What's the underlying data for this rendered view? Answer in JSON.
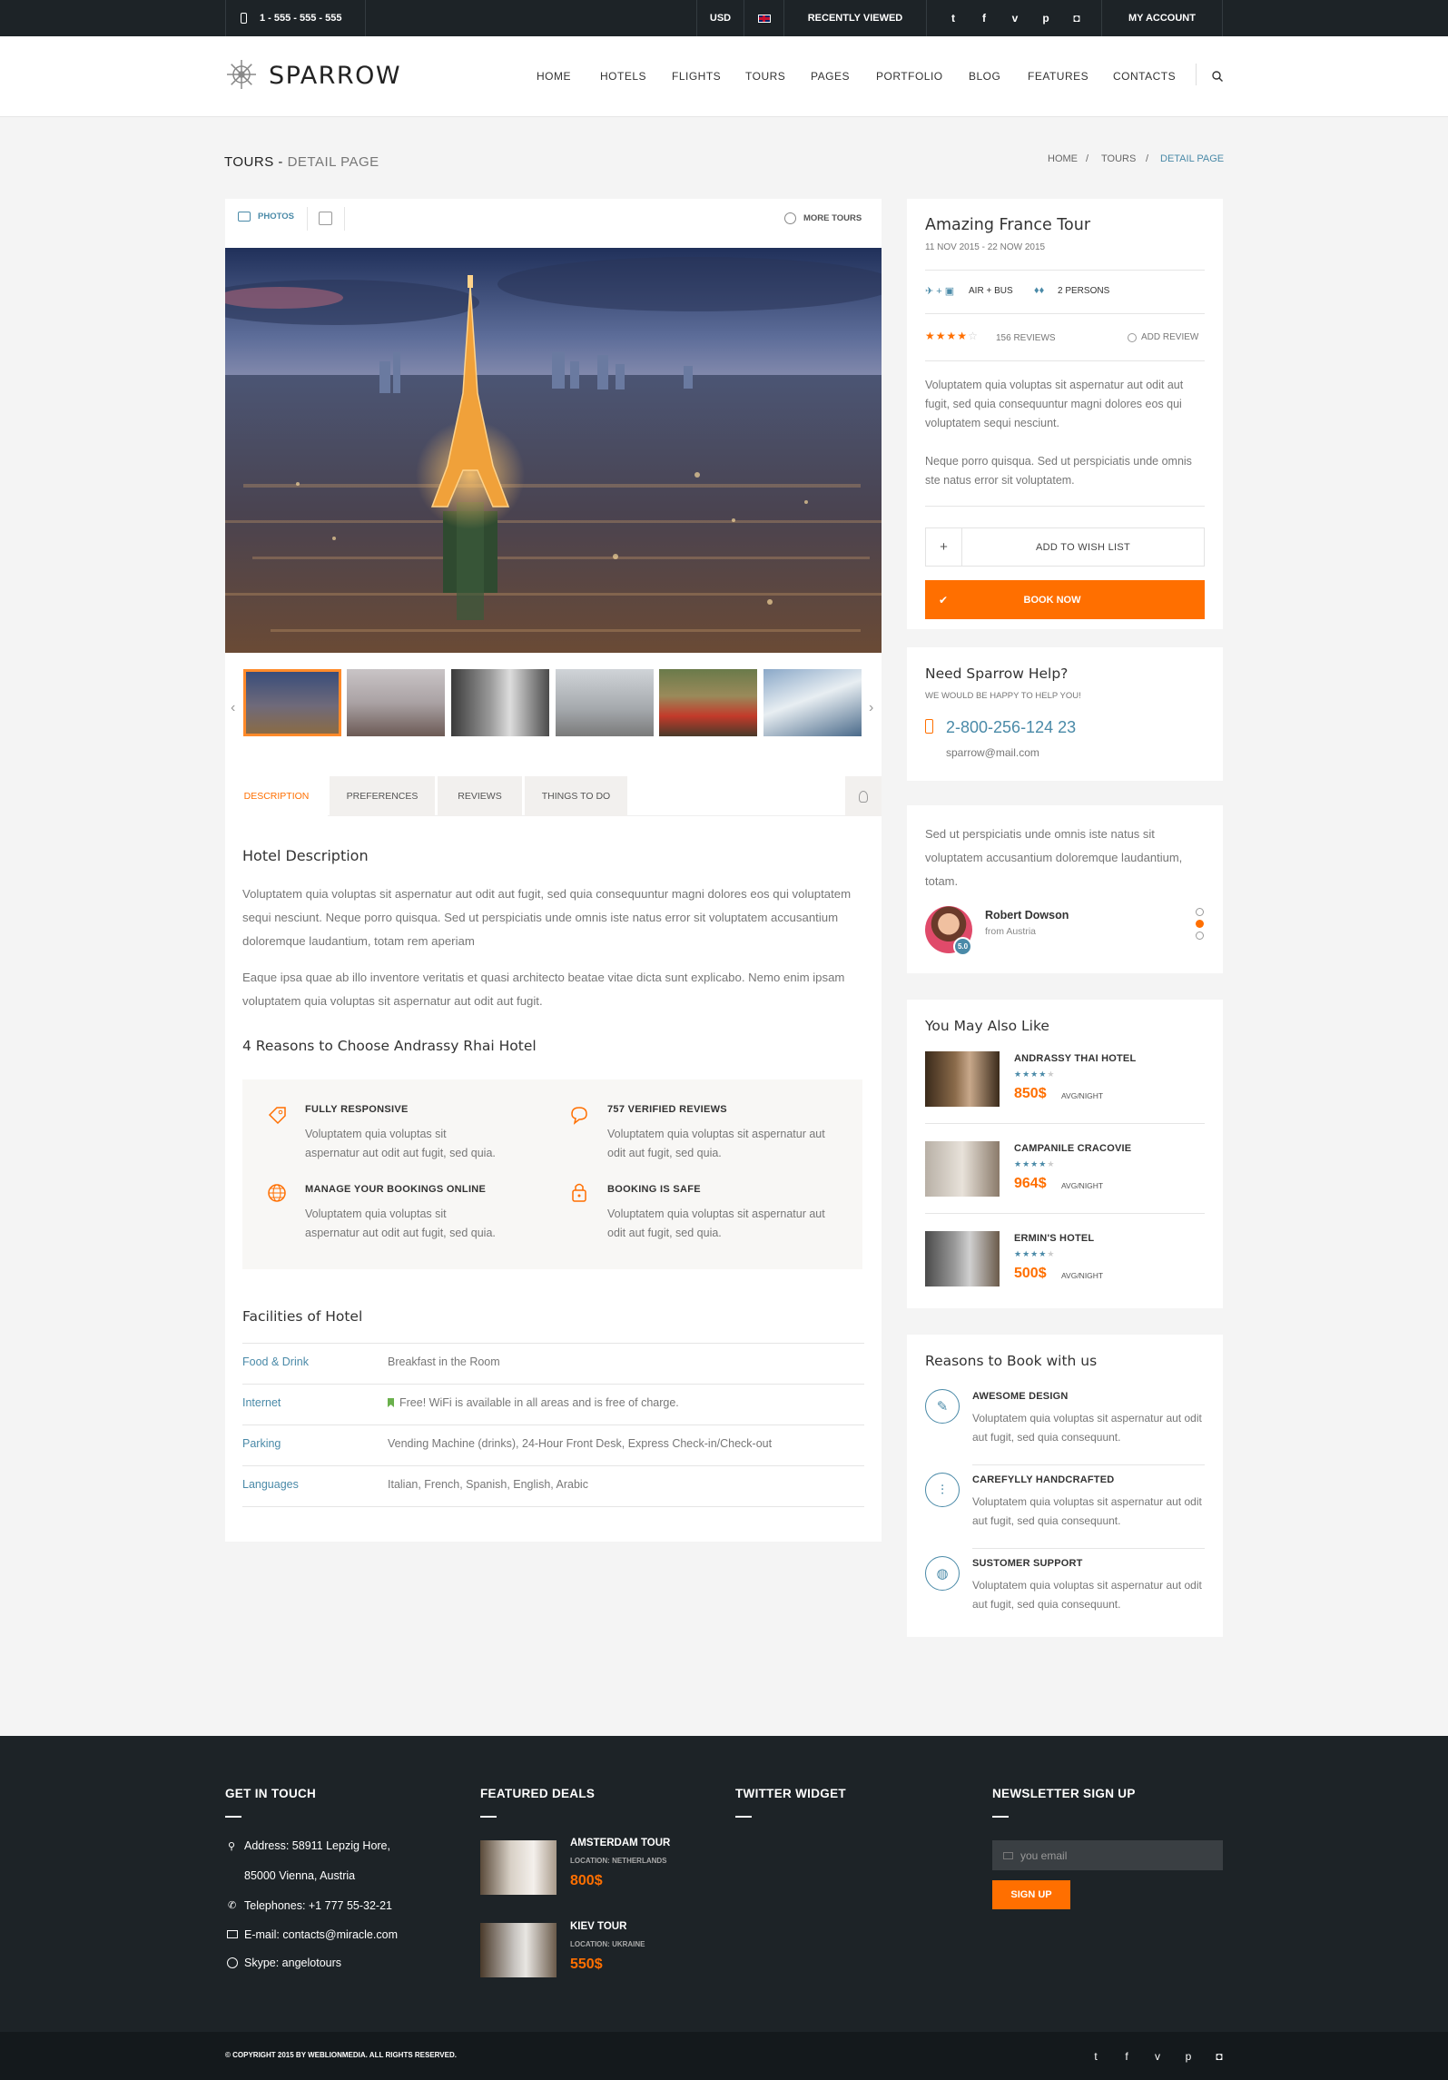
{
  "topbar": {
    "phone": "1 - 555 - 555 - 555",
    "currency": "USD",
    "recently_viewed": "RECENTLY VIEWED",
    "my_account": "MY ACCOUNT",
    "social": [
      "twitter-icon",
      "facebook-icon",
      "vimeo-icon",
      "pinterest-icon",
      "instagram-icon"
    ],
    "social_glyphs": [
      "t",
      "f",
      "v",
      "p",
      "◘"
    ]
  },
  "header": {
    "brand": "SPARROW",
    "nav": [
      "HOME",
      "HOTELS",
      "FLIGHTS",
      "TOURS",
      "PAGES",
      "PORTFOLIO",
      "BLOG",
      "FEATURES",
      "CONTACTS"
    ]
  },
  "page_title": {
    "main": "TOURS - ",
    "sub": "DETAIL PAGE"
  },
  "breadcrumb": {
    "home": "HOME",
    "sep": "/",
    "tours": "TOURS",
    "current": "DETAIL PAGE"
  },
  "gallery": {
    "photos_label": "PHOTOS",
    "more_tours": "MORE TOURS",
    "prev": "‹",
    "next": "›"
  },
  "tabs": [
    "DESCRIPTION",
    "PREFERENCES",
    "REVIEWS",
    "THINGS TO DO"
  ],
  "description": {
    "title": "Hotel Description",
    "p1": "Voluptatem quia voluptas sit aspernatur aut odit aut fugit, sed quia consequuntur magni dolores eos qui voluptatem sequi nesciunt. Neque porro quisqua. Sed ut perspiciatis unde omnis iste natus error sit voluptatem accusantium doloremque laudantium, totam rem aperiam",
    "p2": "Eaque ipsa quae ab illo inventore veritatis et quasi architecto beatae vitae dicta sunt explicabo. Nemo enim ipsam voluptatem quia voluptas sit aspernatur aut odit aut fugit.",
    "reasons_title": "4 Reasons to Choose Andrassy Rhai Hotel",
    "reasons": [
      {
        "title": "FULLY RESPONSIVE",
        "text": "Voluptatem quia voluptas sit aspernatur aut odit aut fugit, sed quia."
      },
      {
        "title": "757 VERIFIED REVIEWS",
        "text": "Voluptatem quia voluptas sit aspernatur aut odit aut fugit, sed quia."
      },
      {
        "title": "MANAGE YOUR BOOKINGS ONLINE",
        "text": "Voluptatem quia voluptas sit aspernatur aut odit aut fugit, sed quia."
      },
      {
        "title": "BOOKING IS SAFE",
        "text": "Voluptatem quia voluptas sit aspernatur aut odit aut fugit, sed quia."
      }
    ],
    "facilities_title": "Facilities of Hotel",
    "facilities": [
      {
        "label": "Food & Drink",
        "value": "Breakfast in the Room"
      },
      {
        "label": "Internet",
        "value": "Free! WiFi is available in all areas and is free of charge."
      },
      {
        "label": "Parking",
        "value": "Vending Machine (drinks), 24-Hour Front Desk, Express Check-in/Check-out"
      },
      {
        "label": "Languages",
        "value": "Italian, French, Spanish, English, Arabic"
      }
    ]
  },
  "tour": {
    "title": "Amazing France Tour",
    "dates": "11 NOV 2015 - 22 NOW 2015",
    "transport": "AIR + BUS",
    "persons": "2 PERSONS",
    "rating": 4,
    "reviews": "156 REVIEWS",
    "add_review": "ADD REVIEW",
    "p1": "Voluptatem quia voluptas sit aspernatur aut odit aut fugit, sed quia consequuntur magni dolores eos qui voluptatem sequi nesciunt.",
    "p2": "Neque porro quisqua. Sed ut perspiciatis unde omnis ste natus error sit voluptatem.",
    "wishlist": "ADD TO WISH LIST",
    "wish_plus": "+",
    "book": "BOOK NOW",
    "book_check": "✔"
  },
  "help": {
    "title": "Need Sparrow Help?",
    "sub": "WE WOULD BE HAPPY TO HELP YOU!",
    "phone": "2-800-256-124 23",
    "email": "sparrow@mail.com"
  },
  "testimonial": {
    "text": "Sed ut perspiciatis unde omnis iste natus sit voluptatem accusantium doloremque laudantium, totam.",
    "name": "Robert Dowson",
    "from": "from Austria",
    "score": "5.0",
    "active_dot": 1
  },
  "also": {
    "title": "You May Also Like",
    "unit": "AVG/NIGHT",
    "items": [
      {
        "name": "ANDRASSY THAI HOTEL",
        "price": "850$",
        "stars": 4
      },
      {
        "name": "CAMPANILE CRACOVIE",
        "price": "964$",
        "stars": 4
      },
      {
        "name": "ERMIN'S HOTEL",
        "price": "500$",
        "stars": 4
      }
    ]
  },
  "reasons_book": {
    "title": "Reasons to Book with us",
    "items": [
      {
        "title": "AWESOME DESIGN",
        "text": "Voluptatem quia voluptas sit aspernatur aut odit aut fugit, sed quia consequunt.",
        "icon": "pencil-icon"
      },
      {
        "title": "CAREFYLLY HANDCRAFTED",
        "text": "Voluptatem quia voluptas sit aspernatur aut odit aut fugit, sed quia consequunt.",
        "icon": "sliders-icon"
      },
      {
        "title": "SUSTOMER SUPPORT",
        "text": "Voluptatem quia voluptas sit aspernatur aut odit aut fugit, sed quia consequunt.",
        "icon": "globe-icon"
      }
    ]
  },
  "footer": {
    "get_in_touch": "GET IN TOUCH",
    "featured": "FEATURED DEALS",
    "twitter": "TWITTER WIDGET",
    "newsletter": "NEWSLETTER SIGN UP",
    "address1": "Address: 58911 Lepzig Hore,",
    "address2": "85000 Vienna, Austria",
    "tel": "Telephones: +1 777 55-32-21",
    "email": "E-mail: contacts@miracle.com",
    "skype": "Skype: angelotours",
    "deals": [
      {
        "name": "AMSTERDAM TOUR",
        "loc": "LOCATION: NETHERLANDS",
        "price": "800$"
      },
      {
        "name": "KIEV TOUR",
        "loc": "LOCATION: UKRAINE",
        "price": "550$"
      }
    ],
    "email_placeholder": "you email",
    "signup": "SIGN UP",
    "copyright": "© COPYRIGHT 2015 BY WEBLIONMEDIA. ALL RIGHTS RESERVED."
  },
  "colors": {
    "accent": "#ff6f00",
    "blue": "#4a8aa8",
    "dark": "#1d2327"
  }
}
